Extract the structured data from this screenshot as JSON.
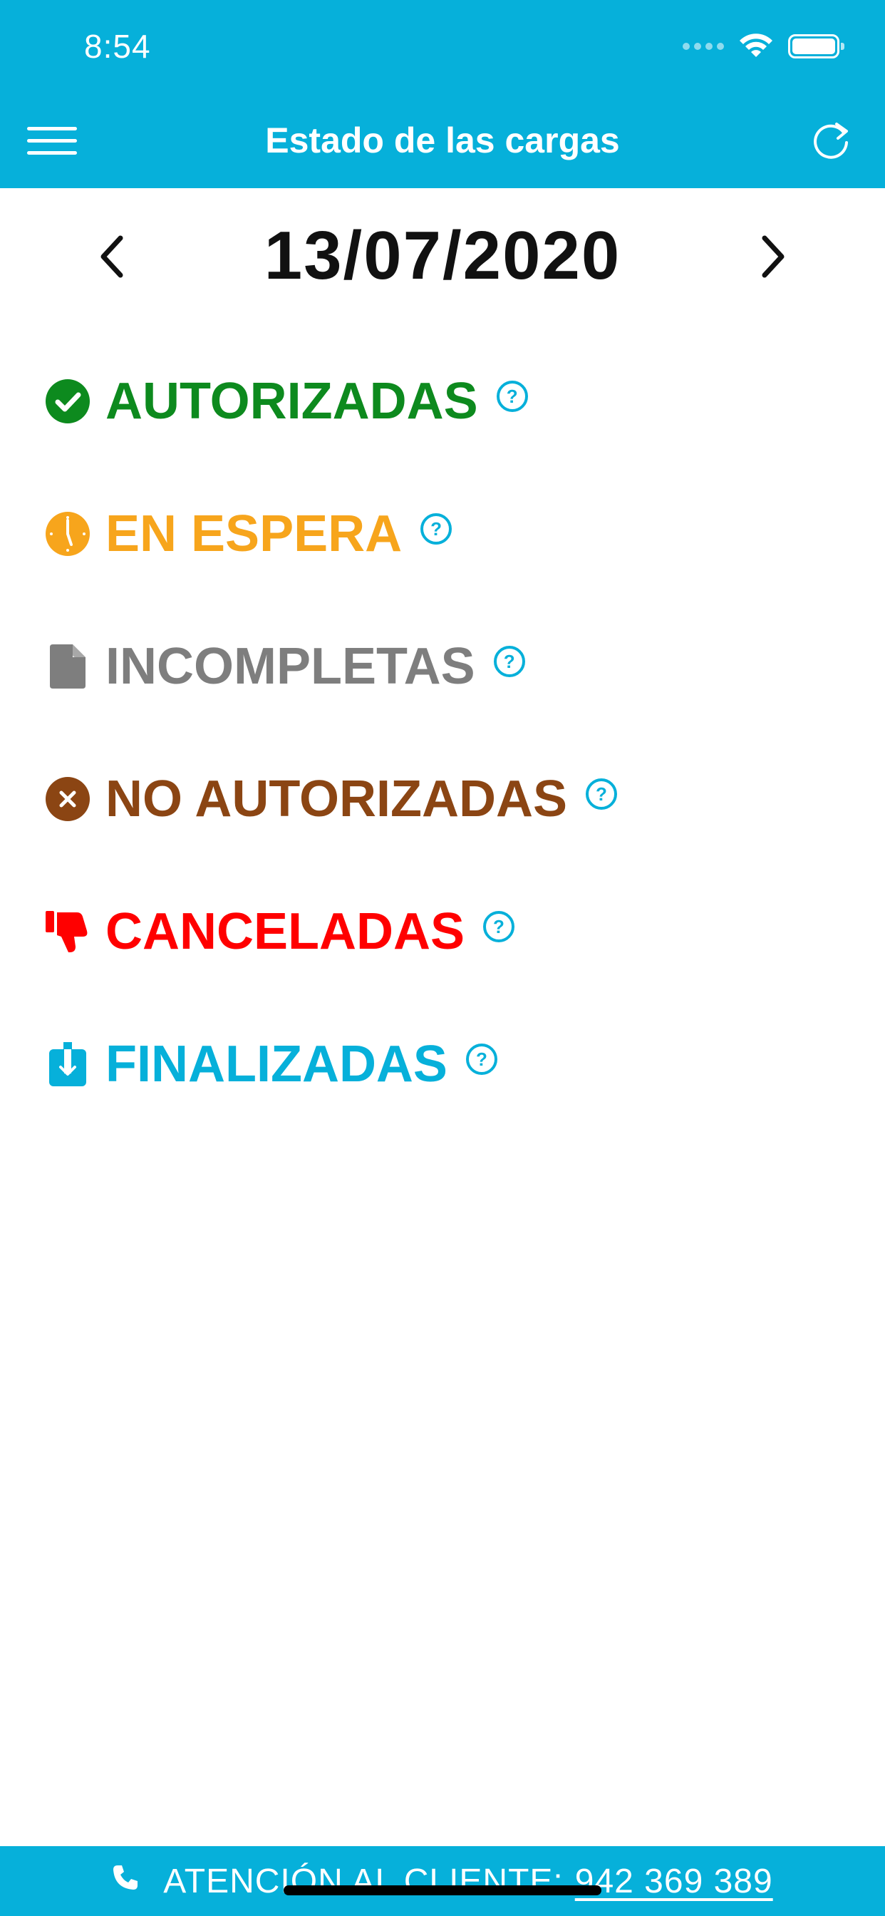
{
  "status_bar": {
    "time": "8:54"
  },
  "header": {
    "title": "Estado de las cargas",
    "menu_icon": "hamburger-menu-icon",
    "refresh_icon": "refresh-icon"
  },
  "date_nav": {
    "date": "13/07/2020",
    "prev_icon": "chevron-left-icon",
    "next_icon": "chevron-right-icon"
  },
  "statuses": [
    {
      "label": "AUTORIZADAS",
      "color": "#0D8A1E",
      "icon": "check-circle-icon"
    },
    {
      "label": "EN ESPERA",
      "color": "#F7A51C",
      "icon": "clock-icon"
    },
    {
      "label": "INCOMPLETAS",
      "color": "#7E7E7E",
      "icon": "document-icon"
    },
    {
      "label": "NO AUTORIZADAS",
      "color": "#8B4513",
      "icon": "close-circle-icon"
    },
    {
      "label": "CANCELADAS",
      "color": "#FF0000",
      "icon": "thumbs-down-icon"
    },
    {
      "label": "FINALIZADAS",
      "color": "#06B0DA",
      "icon": "download-icon"
    }
  ],
  "help_icon_glyph": "?",
  "footer": {
    "label": "ATENCIÓN AL CLIENTE:",
    "phone": "942 369 389"
  },
  "colors": {
    "primary": "#06B0DA"
  }
}
